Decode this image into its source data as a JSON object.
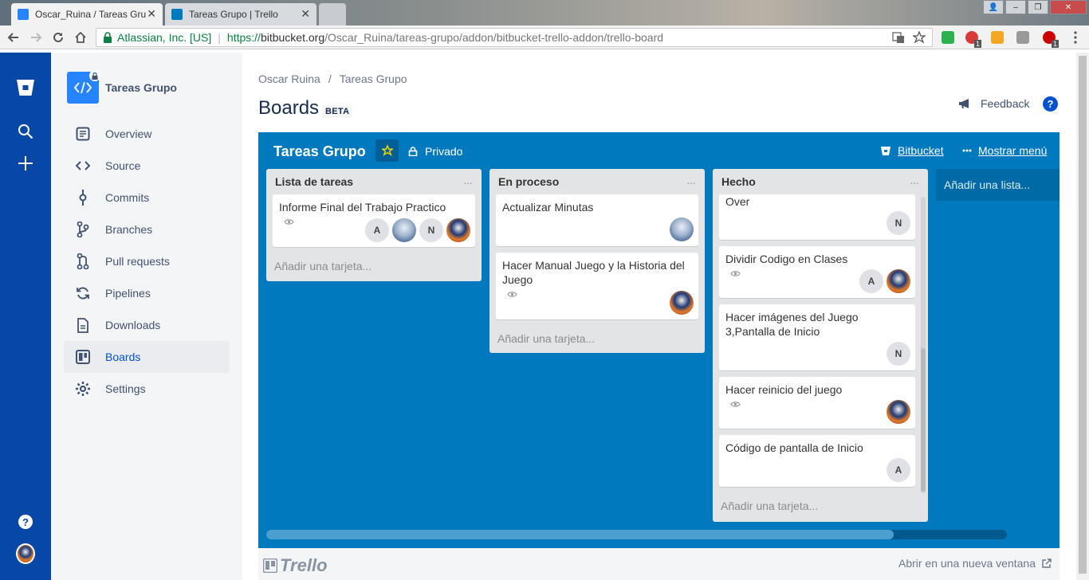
{
  "browser": {
    "tabs": [
      {
        "title": "Oscar_Ruina / Tareas Gru",
        "active": true
      },
      {
        "title": "Tareas Grupo | Trello",
        "active": false
      }
    ],
    "security_label": "Atlassian, Inc. [US]",
    "url": {
      "proto": "https://",
      "domain": "bitbucket.org",
      "path": "/Oscar_Ruina/tareas-grupo/addon/bitbucket-trello-addon/trello-board"
    },
    "extension_badges": [
      "1",
      "1"
    ],
    "window_buttons": [
      "👤",
      "–",
      "❐",
      "✕"
    ]
  },
  "project": {
    "name": "Tareas Grupo",
    "nav": [
      {
        "label": "Overview",
        "icon": "overview-icon"
      },
      {
        "label": "Source",
        "icon": "source-icon"
      },
      {
        "label": "Commits",
        "icon": "commits-icon"
      },
      {
        "label": "Branches",
        "icon": "branches-icon"
      },
      {
        "label": "Pull requests",
        "icon": "pull-requests-icon"
      },
      {
        "label": "Pipelines",
        "icon": "pipelines-icon"
      },
      {
        "label": "Downloads",
        "icon": "downloads-icon"
      },
      {
        "label": "Boards",
        "icon": "boards-icon",
        "active": true
      },
      {
        "label": "Settings",
        "icon": "settings-icon"
      }
    ]
  },
  "main": {
    "breadcrumb": [
      "Oscar Ruina",
      "Tareas Grupo"
    ],
    "breadcrumb_sep": "/",
    "title": "Boards",
    "beta": "BETA",
    "feedback": "Feedback",
    "help": "?"
  },
  "board": {
    "title": "Tareas Grupo",
    "privacy": "Privado",
    "bitbucket_link": "Bitbucket",
    "menu_link": "Mostrar menú",
    "add_list": "Añadir una lista...",
    "add_card": "Añadir una tarjeta...",
    "list_menu": "···",
    "lists": [
      {
        "name": "Lista de tareas",
        "cards": [
          {
            "text": "Informe Final del Trabajo Practico",
            "watch": true,
            "members": [
              "A",
              "photo-a",
              "N",
              "photo-b"
            ]
          }
        ]
      },
      {
        "name": "En proceso",
        "cards": [
          {
            "text": "Actualizar Minutas",
            "watch": false,
            "members": [
              "photo-a"
            ]
          },
          {
            "text": "Hacer Manual Juego y la Historia del Juego",
            "watch": true,
            "members": [
              "photo-b"
            ]
          }
        ]
      },
      {
        "name": "Hecho",
        "cards": [
          {
            "text": "Over",
            "watch": false,
            "members": [
              "N"
            ]
          },
          {
            "text": "Dividir Codigo en Clases",
            "watch": true,
            "members": [
              "A",
              "photo-b"
            ]
          },
          {
            "text": "Hacer imágenes del Juego 3,Pantalla de Inicio",
            "watch": false,
            "members": [
              "N"
            ]
          },
          {
            "text": "Hacer reinicio del juego",
            "watch": true,
            "members": [
              "photo-b"
            ]
          },
          {
            "text": "Código de pantalla de Inicio",
            "watch": false,
            "members": [
              "A"
            ]
          }
        ]
      }
    ]
  },
  "footer": {
    "logo": "Trello",
    "open_new": "Abrir en una nueva ventana"
  }
}
